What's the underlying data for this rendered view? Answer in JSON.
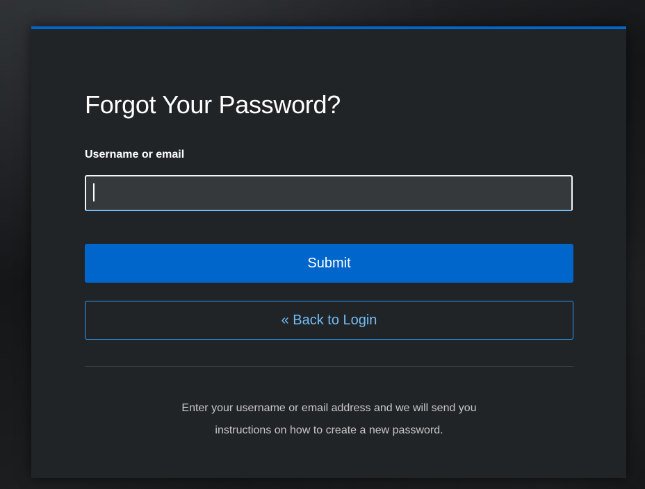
{
  "form": {
    "title": "Forgot Your Password?",
    "username_label": "Username or email",
    "username_value": "",
    "submit_label": "Submit",
    "back_label": "« Back to Login",
    "help_text_line1": "Enter your username or email address and we will send you",
    "help_text_line2": "instructions on how to create a new password."
  },
  "colors": {
    "accent": "#0066cc",
    "link": "#73bcf7",
    "card_background": "#212427",
    "input_background": "#36393b",
    "text": "#ffffff",
    "muted_text": "#c7c7c7"
  }
}
